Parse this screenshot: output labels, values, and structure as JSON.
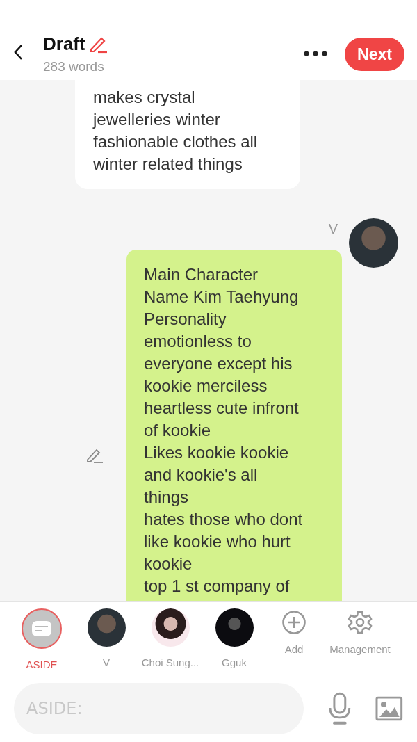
{
  "header": {
    "title": "Draft",
    "word_count": "283 words",
    "next_button": "Next"
  },
  "messages": [
    {
      "kind": "narration",
      "text": "makes crystal\njewelleries winter\nfashionable clothes all\nwinter related things"
    },
    {
      "kind": "character",
      "speaker": "V",
      "text": "Main Character\nName Kim Taehyung\nPersonality\nemotionless to\neveryone except his\nkookie merciless\nheartless cute infront\nof kookie\nLikes kookie kookie\nand kookie's all\nthings\nhates those who dont\nlike kookie who hurt\nkookie\ntop 1 st company of"
    }
  ],
  "characters": [
    {
      "kind": "aside",
      "label": "ASIDE",
      "selected": true
    },
    {
      "kind": "avatar",
      "label": "V",
      "selected": false
    },
    {
      "kind": "avatar",
      "label": "Choi Sung...",
      "selected": false
    },
    {
      "kind": "avatar",
      "label": "Gguk",
      "selected": false
    },
    {
      "kind": "add",
      "label": "Add",
      "selected": false
    },
    {
      "kind": "manage",
      "label": "Management",
      "selected": false
    }
  ],
  "composer": {
    "placeholder": "ASIDE:"
  }
}
